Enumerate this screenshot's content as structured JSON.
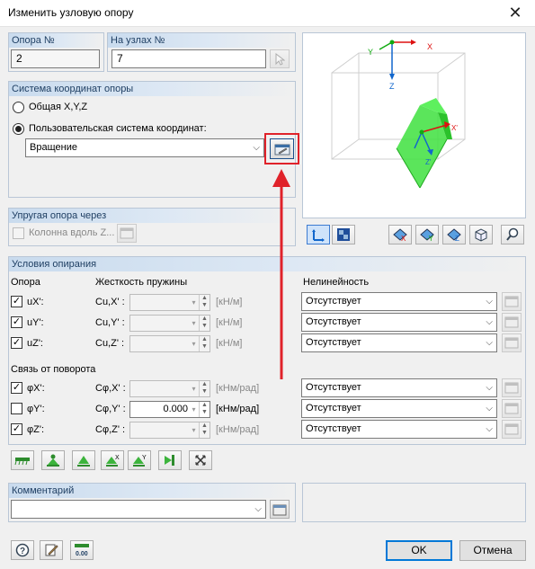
{
  "window": {
    "title": "Изменить узловую опору",
    "close_glyph": "✕"
  },
  "support_no": {
    "label": "Опора №",
    "value": "2"
  },
  "nodes_no": {
    "label": "На узлах №",
    "value": "7"
  },
  "coord_system": {
    "label": "Система координат опоры",
    "option_global": "Общая X,Y,Z",
    "option_user": "Пользовательская система координат:",
    "selected": "user",
    "dropdown_value": "Вращение"
  },
  "elastic": {
    "label": "Упругая опора через",
    "column_label": "Колонна вдоль Z..."
  },
  "preview_axes": {
    "x": "X",
    "y": "Y",
    "z": "Z",
    "lx": "X'",
    "lz": "Z'"
  },
  "view_toolbar": [
    "axes-icon",
    "display-icon",
    "view-x-icon",
    "view-y-icon",
    "view-z-icon",
    "isometric-icon",
    "zoom-icon"
  ],
  "conditions": {
    "label": "Условия опирания",
    "col_support": "Опора",
    "col_stiffness": "Жесткость пружины",
    "col_nonlinearity": "Нелинейность",
    "rotation_header": "Связь от поворота",
    "translation_rows": [
      {
        "label": "uX':",
        "checked": true,
        "coef": "Cu,X' :",
        "value": "",
        "unit": "[кН/м]",
        "nonlin": "Отсутствует"
      },
      {
        "label": "uY':",
        "checked": true,
        "coef": "Cu,Y' :",
        "value": "",
        "unit": "[кН/м]",
        "nonlin": "Отсутствует"
      },
      {
        "label": "uZ':",
        "checked": true,
        "coef": "Cu,Z' :",
        "value": "",
        "unit": "[кН/м]",
        "nonlin": "Отсутствует"
      }
    ],
    "rotation_rows": [
      {
        "label": "φX':",
        "checked": true,
        "coef": "Cφ,X' :",
        "value": "",
        "unit": "[кНм/рад]",
        "nonlin": "Отсутствует"
      },
      {
        "label": "φY':",
        "checked": false,
        "coef": "Cφ,Y' :",
        "value": "0.000",
        "unit": "[кНм/рад]",
        "nonlin": "Отсутствует"
      },
      {
        "label": "φZ':",
        "checked": true,
        "coef": "Cφ,Z' :",
        "value": "",
        "unit": "[кНм/рад]",
        "nonlin": "Отсутствует"
      }
    ]
  },
  "support_types": [
    "fixed-support-icon",
    "hinged-support-icon",
    "roller-support-icon",
    "roller-x-support-icon",
    "roller-y-support-icon",
    "clamped-wall-icon",
    "free-support-icon"
  ],
  "comment": {
    "label": "Комментарий",
    "value": ""
  },
  "footer": {
    "ok": "OK",
    "cancel": "Отмена",
    "units_icon_text": "0.00"
  },
  "colors": {
    "highlight": "#e0222a",
    "frame_head": "#c9dbee",
    "green_solid": "#33dd33"
  }
}
